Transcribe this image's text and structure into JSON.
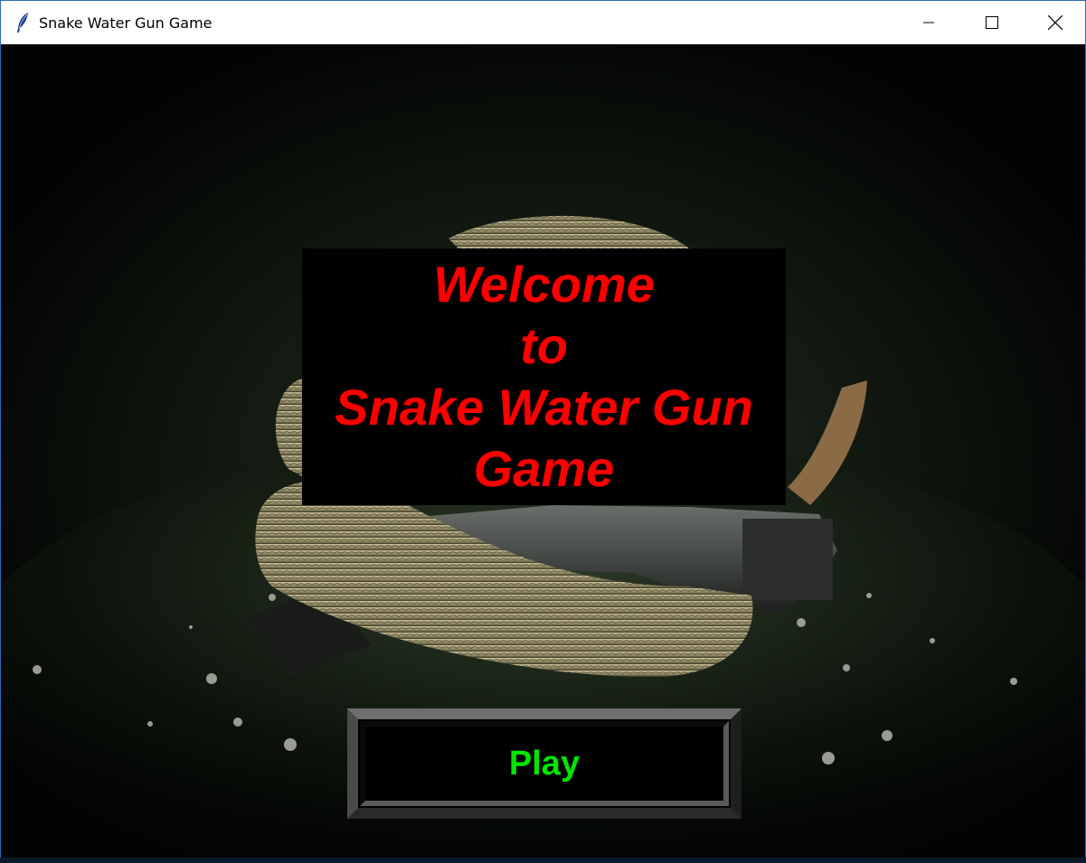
{
  "window": {
    "title": "Snake Water Gun Game",
    "app_icon": "feather-icon",
    "controls": [
      "minimize-icon",
      "maximize-icon",
      "close-icon"
    ]
  },
  "welcome": {
    "lines": [
      "Welcome",
      "to",
      "Snake Water Gun",
      "Game"
    ],
    "text_color": "#ff0000",
    "panel_color": "#000000"
  },
  "play_button": {
    "label": "Play",
    "text_color": "#00e600",
    "bg_color": "#000000"
  },
  "background": {
    "image": "snake coiled around a pistol on dark ground"
  }
}
